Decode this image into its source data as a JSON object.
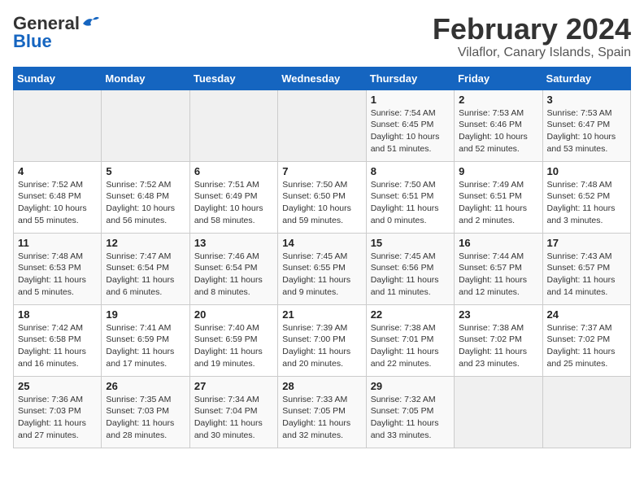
{
  "logo": {
    "line1": "General",
    "line2": "Blue"
  },
  "title": "February 2024",
  "subtitle": "Vilaflor, Canary Islands, Spain",
  "days_of_week": [
    "Sunday",
    "Monday",
    "Tuesday",
    "Wednesday",
    "Thursday",
    "Friday",
    "Saturday"
  ],
  "weeks": [
    [
      {
        "day": "",
        "detail": ""
      },
      {
        "day": "",
        "detail": ""
      },
      {
        "day": "",
        "detail": ""
      },
      {
        "day": "",
        "detail": ""
      },
      {
        "day": "1",
        "detail": "Sunrise: 7:54 AM\nSunset: 6:45 PM\nDaylight: 10 hours\nand 51 minutes."
      },
      {
        "day": "2",
        "detail": "Sunrise: 7:53 AM\nSunset: 6:46 PM\nDaylight: 10 hours\nand 52 minutes."
      },
      {
        "day": "3",
        "detail": "Sunrise: 7:53 AM\nSunset: 6:47 PM\nDaylight: 10 hours\nand 53 minutes."
      }
    ],
    [
      {
        "day": "4",
        "detail": "Sunrise: 7:52 AM\nSunset: 6:48 PM\nDaylight: 10 hours\nand 55 minutes."
      },
      {
        "day": "5",
        "detail": "Sunrise: 7:52 AM\nSunset: 6:48 PM\nDaylight: 10 hours\nand 56 minutes."
      },
      {
        "day": "6",
        "detail": "Sunrise: 7:51 AM\nSunset: 6:49 PM\nDaylight: 10 hours\nand 58 minutes."
      },
      {
        "day": "7",
        "detail": "Sunrise: 7:50 AM\nSunset: 6:50 PM\nDaylight: 10 hours\nand 59 minutes."
      },
      {
        "day": "8",
        "detail": "Sunrise: 7:50 AM\nSunset: 6:51 PM\nDaylight: 11 hours\nand 0 minutes."
      },
      {
        "day": "9",
        "detail": "Sunrise: 7:49 AM\nSunset: 6:51 PM\nDaylight: 11 hours\nand 2 minutes."
      },
      {
        "day": "10",
        "detail": "Sunrise: 7:48 AM\nSunset: 6:52 PM\nDaylight: 11 hours\nand 3 minutes."
      }
    ],
    [
      {
        "day": "11",
        "detail": "Sunrise: 7:48 AM\nSunset: 6:53 PM\nDaylight: 11 hours\nand 5 minutes."
      },
      {
        "day": "12",
        "detail": "Sunrise: 7:47 AM\nSunset: 6:54 PM\nDaylight: 11 hours\nand 6 minutes."
      },
      {
        "day": "13",
        "detail": "Sunrise: 7:46 AM\nSunset: 6:54 PM\nDaylight: 11 hours\nand 8 minutes."
      },
      {
        "day": "14",
        "detail": "Sunrise: 7:45 AM\nSunset: 6:55 PM\nDaylight: 11 hours\nand 9 minutes."
      },
      {
        "day": "15",
        "detail": "Sunrise: 7:45 AM\nSunset: 6:56 PM\nDaylight: 11 hours\nand 11 minutes."
      },
      {
        "day": "16",
        "detail": "Sunrise: 7:44 AM\nSunset: 6:57 PM\nDaylight: 11 hours\nand 12 minutes."
      },
      {
        "day": "17",
        "detail": "Sunrise: 7:43 AM\nSunset: 6:57 PM\nDaylight: 11 hours\nand 14 minutes."
      }
    ],
    [
      {
        "day": "18",
        "detail": "Sunrise: 7:42 AM\nSunset: 6:58 PM\nDaylight: 11 hours\nand 16 minutes."
      },
      {
        "day": "19",
        "detail": "Sunrise: 7:41 AM\nSunset: 6:59 PM\nDaylight: 11 hours\nand 17 minutes."
      },
      {
        "day": "20",
        "detail": "Sunrise: 7:40 AM\nSunset: 6:59 PM\nDaylight: 11 hours\nand 19 minutes."
      },
      {
        "day": "21",
        "detail": "Sunrise: 7:39 AM\nSunset: 7:00 PM\nDaylight: 11 hours\nand 20 minutes."
      },
      {
        "day": "22",
        "detail": "Sunrise: 7:38 AM\nSunset: 7:01 PM\nDaylight: 11 hours\nand 22 minutes."
      },
      {
        "day": "23",
        "detail": "Sunrise: 7:38 AM\nSunset: 7:02 PM\nDaylight: 11 hours\nand 23 minutes."
      },
      {
        "day": "24",
        "detail": "Sunrise: 7:37 AM\nSunset: 7:02 PM\nDaylight: 11 hours\nand 25 minutes."
      }
    ],
    [
      {
        "day": "25",
        "detail": "Sunrise: 7:36 AM\nSunset: 7:03 PM\nDaylight: 11 hours\nand 27 minutes."
      },
      {
        "day": "26",
        "detail": "Sunrise: 7:35 AM\nSunset: 7:03 PM\nDaylight: 11 hours\nand 28 minutes."
      },
      {
        "day": "27",
        "detail": "Sunrise: 7:34 AM\nSunset: 7:04 PM\nDaylight: 11 hours\nand 30 minutes."
      },
      {
        "day": "28",
        "detail": "Sunrise: 7:33 AM\nSunset: 7:05 PM\nDaylight: 11 hours\nand 32 minutes."
      },
      {
        "day": "29",
        "detail": "Sunrise: 7:32 AM\nSunset: 7:05 PM\nDaylight: 11 hours\nand 33 minutes."
      },
      {
        "day": "",
        "detail": ""
      },
      {
        "day": "",
        "detail": ""
      }
    ]
  ]
}
